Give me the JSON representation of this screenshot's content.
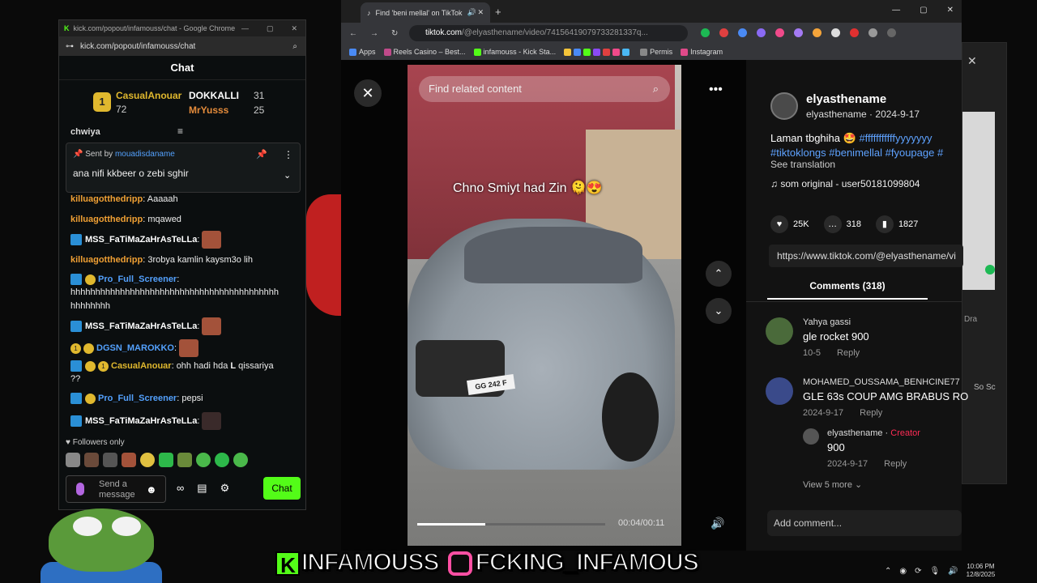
{
  "chat_window": {
    "title": "kick.com/popout/infamouss/chat - Google Chrome",
    "url": "kick.com/popout/infamouss/chat",
    "header": "Chat",
    "leaderboard": [
      {
        "rank": "1",
        "name": "CasualAnouar",
        "score": "72"
      },
      {
        "name": "DOKKALLI",
        "score": "31"
      },
      {
        "name": "MrYusss",
        "score": "25"
      }
    ],
    "cut_text": "chwiya",
    "pinned": {
      "sent_by_label": "Sent by",
      "sender": "mouadisdaname",
      "message": "ana nifi kkbeer o zebi sghir"
    },
    "messages": [
      {
        "user": "killuagotthedripp",
        "text": ": Aaaaah"
      },
      {
        "user": "killuagotthedripp",
        "text": ": mqawed"
      },
      {
        "user": "MSS_FaTiMaZaHrAsTeLLa",
        "text": ":"
      },
      {
        "user": "killuagotthedripp",
        "text": ": 3robya kamlin kaysm3o lih"
      },
      {
        "user": "Pro_Full_Screener",
        "text": ":"
      },
      {
        "text": "hhhhhhhhhhhhhhhhhhhhhhhhhhhhhhhhhhhhhhhhhh"
      },
      {
        "text": "hhhhhhhh"
      },
      {
        "user": "MSS_FaTiMaZaHrAsTeLLa",
        "text": ":"
      },
      {
        "user": "DGSN_MAROKKO",
        "text": ":"
      },
      {
        "user": "CasualAnouar",
        "text": ": ohh hadi hda",
        "text2": "qissariya"
      },
      {
        "text": "??"
      },
      {
        "user": "Pro_Full_Screener",
        "text": ": pepsi"
      },
      {
        "user": "MSS_FaTiMaZaHrAsTeLLa",
        "text": ":"
      }
    ],
    "followers_only": "Followers only",
    "input_placeholder": "Send a message",
    "chat_button": "Chat"
  },
  "browser": {
    "tab_title": "Find 'beni mellal' on TikTok",
    "url_host": "tiktok.com",
    "url_path": "/@elyasthename/video/74156419079733281337q...",
    "bookmarks": [
      "Apps",
      "Reels Casino – Best...",
      "infamouss - Kick Sta...",
      "Permis",
      "Instagram"
    ]
  },
  "tiktok": {
    "search_placeholder": "Find related content",
    "caption": "Chno Smiyt had Zin 🫠😍",
    "plate": "GG 242 F",
    "time": "00:04/00:11",
    "progress": 0.36,
    "author": {
      "name": "elyasthename",
      "handle": "elyasthename",
      "date": "2024-9-17"
    },
    "description": "Laman tbghiha 🤩",
    "description_tags": "#fffffffffffyyyyyyy",
    "description_line2": "#tiktoklongs #benimellal #fyoupage #",
    "see_translation": "See translation",
    "music": "som original - user50181099804",
    "likes": "25K",
    "comments_count": "318",
    "saves": "1827",
    "link": "https://www.tiktok.com/@elyasthename/vi",
    "comments_tab": "Comments (318)",
    "comments": [
      {
        "user": "Yahya gassi",
        "text": "gle rocket 900",
        "date": "10-5",
        "reply": "Reply"
      },
      {
        "user": "MOHAMED_OUSSAMA_BENHCINE77",
        "text": "GLE 63s COUP AMG BRABUS RO",
        "date": "2024-9-17",
        "reply": "Reply"
      }
    ],
    "reply": {
      "user": "elyasthename",
      "tag": "Creator",
      "text": "900",
      "date": "2024-9-17",
      "reply": "Reply"
    },
    "view_more": "View 5 more",
    "add_comment": "Add comment..."
  },
  "background_window": {
    "text1": "Dra",
    "text2": "So Sc"
  },
  "banner": {
    "kick": "INFAMOUSS",
    "insta": "FCKING_INFAMOUS"
  },
  "taskbar": {
    "time": "10:06 PM",
    "date": "12/8/2025"
  }
}
